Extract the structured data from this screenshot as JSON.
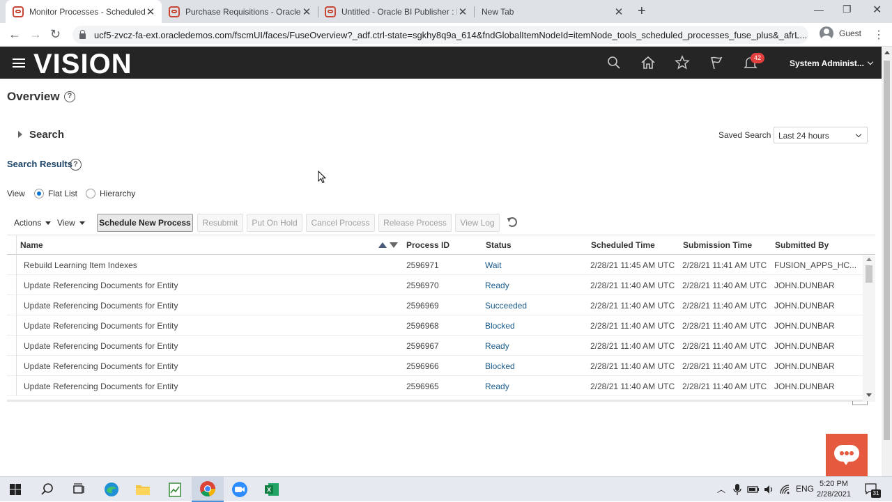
{
  "browser": {
    "tabs": [
      {
        "title": "Monitor Processes - Scheduled P",
        "active": true
      },
      {
        "title": "Purchase Requisitions - Oracle Ap",
        "active": false
      },
      {
        "title": "Untitled - Oracle BI Publisher : Da",
        "active": false
      },
      {
        "title": "New Tab",
        "active": false
      }
    ],
    "url": "ucf5-zvcz-fa-ext.oracledemos.com/fscmUI/faces/FuseOverview?_adf.ctrl-state=sgkhy8q9a_614&fndGlobalItemNodeId=itemNode_tools_scheduled_processes_fuse_plus&_afrL...",
    "profile": "Guest"
  },
  "app": {
    "logo": "VISION",
    "notification_count": "42",
    "user": "System Administ...",
    "accent": "#e2403e"
  },
  "page": {
    "title": "Overview",
    "search_label": "Search",
    "saved_search_label": "Saved Search",
    "saved_search_value": "Last 24 hours",
    "results_label": "Search Results",
    "view_label": "View",
    "view_options": [
      {
        "label": "Flat List",
        "selected": true
      },
      {
        "label": "Hierarchy",
        "selected": false
      }
    ]
  },
  "toolbar": {
    "actions": "Actions",
    "view": "View",
    "buttons": [
      {
        "label": "Schedule New Process",
        "enabled": true
      },
      {
        "label": "Resubmit",
        "enabled": false
      },
      {
        "label": "Put On Hold",
        "enabled": false
      },
      {
        "label": "Cancel Process",
        "enabled": false
      },
      {
        "label": "Release Process",
        "enabled": false
      },
      {
        "label": "View Log",
        "enabled": false
      }
    ]
  },
  "table": {
    "headers": [
      "Name",
      "Process ID",
      "Status",
      "Scheduled Time",
      "Submission Time",
      "Submitted By"
    ],
    "rows": [
      [
        "Rebuild Learning Item Indexes",
        "2596971",
        "Wait",
        "2/28/21 11:45 AM UTC",
        "2/28/21 11:41 AM UTC",
        "FUSION_APPS_HC..."
      ],
      [
        "Update Referencing Documents for Entity",
        "2596970",
        "Ready",
        "2/28/21 11:40 AM UTC",
        "2/28/21 11:40 AM UTC",
        "JOHN.DUNBAR"
      ],
      [
        "Update Referencing Documents for Entity",
        "2596969",
        "Succeeded",
        "2/28/21 11:40 AM UTC",
        "2/28/21 11:40 AM UTC",
        "JOHN.DUNBAR"
      ],
      [
        "Update Referencing Documents for Entity",
        "2596968",
        "Blocked",
        "2/28/21 11:40 AM UTC",
        "2/28/21 11:40 AM UTC",
        "JOHN.DUNBAR"
      ],
      [
        "Update Referencing Documents for Entity",
        "2596967",
        "Ready",
        "2/28/21 11:40 AM UTC",
        "2/28/21 11:40 AM UTC",
        "JOHN.DUNBAR"
      ],
      [
        "Update Referencing Documents for Entity",
        "2596966",
        "Blocked",
        "2/28/21 11:40 AM UTC",
        "2/28/21 11:40 AM UTC",
        "JOHN.DUNBAR"
      ],
      [
        "Update Referencing Documents for Entity",
        "2596965",
        "Ready",
        "2/28/21 11:40 AM UTC",
        "2/28/21 11:40 AM UTC",
        "JOHN.DUNBAR"
      ]
    ]
  },
  "taskbar": {
    "language": "ENG",
    "time": "5:20 PM",
    "date": "2/28/2021",
    "notifications": "31"
  }
}
